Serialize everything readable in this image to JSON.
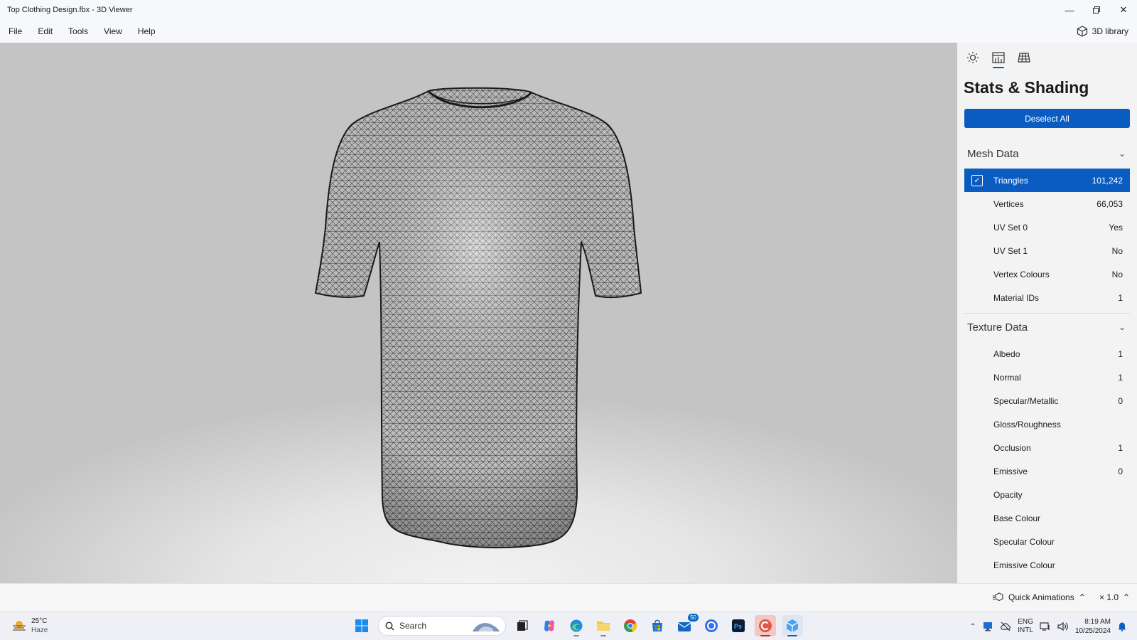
{
  "window": {
    "title": "Top Clothing Design.fbx - 3D Viewer",
    "controls": [
      "minimize",
      "restore",
      "close"
    ]
  },
  "menu": {
    "items": [
      "File",
      "Edit",
      "Tools",
      "View",
      "Help"
    ],
    "library_label": "3D library"
  },
  "panel": {
    "title": "Stats & Shading",
    "deselect_label": "Deselect All",
    "mesh_section": "Mesh Data",
    "mesh_rows": [
      {
        "label": "Triangles",
        "value": "101,242",
        "selected": true
      },
      {
        "label": "Vertices",
        "value": "66,053"
      },
      {
        "label": "UV Set 0",
        "value": "Yes"
      },
      {
        "label": "UV Set 1",
        "value": "No"
      },
      {
        "label": "Vertex Colours",
        "value": "No"
      },
      {
        "label": "Material IDs",
        "value": "1"
      }
    ],
    "texture_section": "Texture Data",
    "texture_rows": [
      {
        "label": "Albedo",
        "value": "1"
      },
      {
        "label": "Normal",
        "value": "1"
      },
      {
        "label": "Specular/Metallic",
        "value": "0"
      },
      {
        "label": "Gloss/Roughness",
        "value": ""
      },
      {
        "label": "Occlusion",
        "value": "1"
      },
      {
        "label": "Emissive",
        "value": "0"
      },
      {
        "label": "Opacity",
        "value": ""
      },
      {
        "label": "Base Colour",
        "value": ""
      },
      {
        "label": "Specular Colour",
        "value": ""
      },
      {
        "label": "Emissive Colour",
        "value": ""
      }
    ]
  },
  "status": {
    "quick_animations": "Quick Animations",
    "speed": "× 1.0"
  },
  "taskbar": {
    "weather_temp": "25°C",
    "weather_desc": "Haze",
    "search_placeholder": "Search",
    "store_badge": "50",
    "lang_line1": "ENG",
    "lang_line2": "INTL",
    "time": "8:19 AM",
    "date": "10/25/2024"
  },
  "colors": {
    "accent": "#0b5cc1",
    "panel_bg": "#f3f3f3"
  }
}
